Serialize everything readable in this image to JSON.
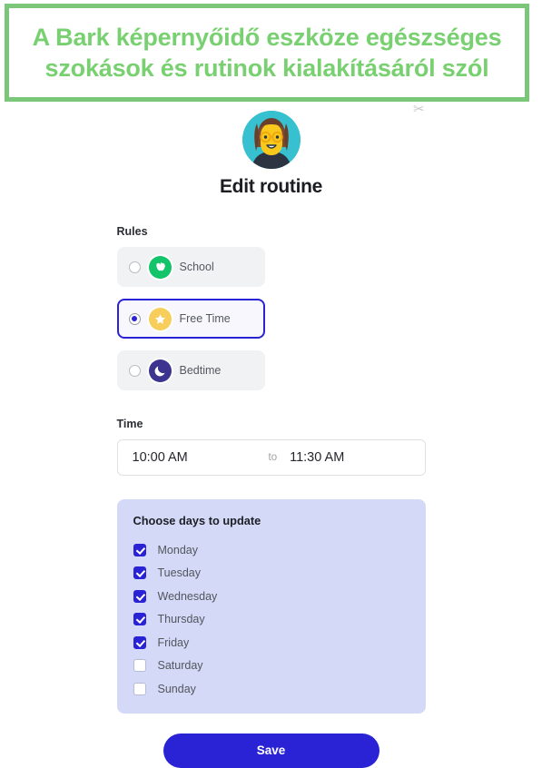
{
  "banner": {
    "text": "A Bark képernyőidő eszköze egészséges szokások és rutinok kialakításáról szól",
    "border_color": "#7ac77a",
    "text_color": "#79d071"
  },
  "watermark": {
    "glyph": "✂"
  },
  "header": {
    "avatar_alt": "avatar",
    "title": "Edit routine"
  },
  "rules": {
    "label": "Rules",
    "options": [
      {
        "id": "school",
        "label": "School",
        "icon": "apple-icon",
        "icon_bg": "#14c46a",
        "selected": false
      },
      {
        "id": "free_time",
        "label": "Free Time",
        "icon": "star-icon",
        "icon_bg": "#f7ce5b",
        "selected": true
      },
      {
        "id": "bedtime",
        "label": "Bedtime",
        "icon": "moon-icon",
        "icon_bg": "#3c348f",
        "selected": false
      }
    ]
  },
  "time": {
    "label": "Time",
    "start": "10:00 AM",
    "separator": "to",
    "end": "11:30 AM"
  },
  "days": {
    "title": "Choose days to update",
    "panel_color": "#d3d9f7",
    "items": [
      {
        "label": "Monday",
        "checked": true
      },
      {
        "label": "Tuesday",
        "checked": true
      },
      {
        "label": "Wednesday",
        "checked": true
      },
      {
        "label": "Thursday",
        "checked": true
      },
      {
        "label": "Friday",
        "checked": true
      },
      {
        "label": "Saturday",
        "checked": false
      },
      {
        "label": "Sunday",
        "checked": false
      }
    ]
  },
  "actions": {
    "save_label": "Save",
    "save_color": "#2a23d6"
  }
}
